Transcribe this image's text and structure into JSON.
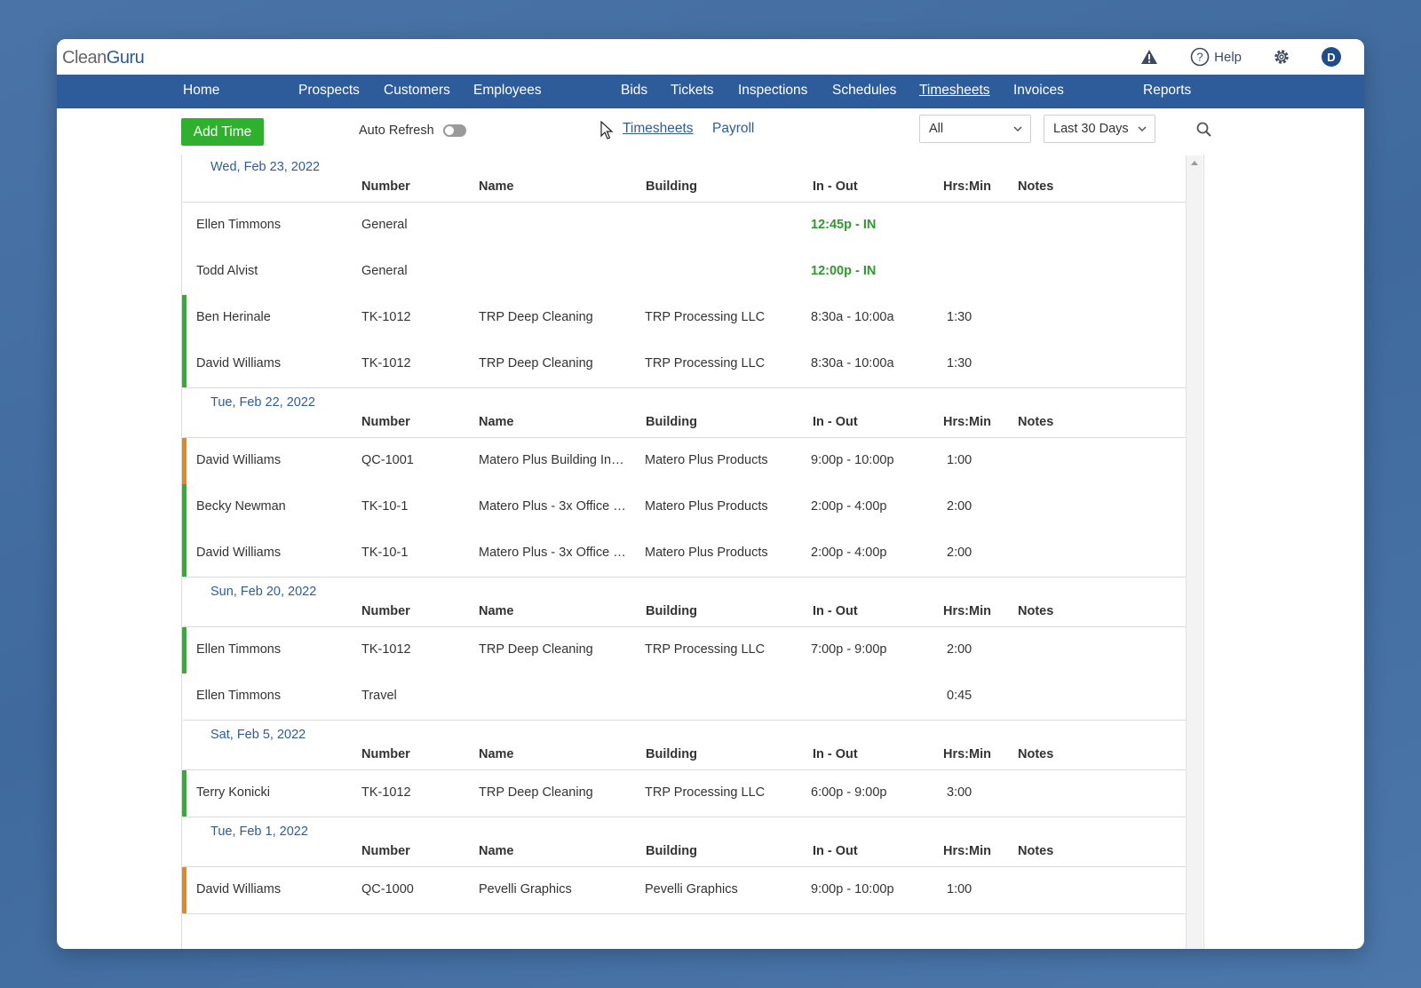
{
  "app": {
    "logo_a": "Clean",
    "logo_b": "Guru",
    "help_label": "Help",
    "avatar_initial": "D"
  },
  "nav": {
    "items": [
      "Home",
      "Prospects",
      "Customers",
      "Employees",
      "Bids",
      "Tickets",
      "Inspections",
      "Schedules",
      "Timesheets",
      "Invoices",
      "Reports"
    ],
    "active": "Timesheets"
  },
  "toolbar": {
    "add_label": "Add Time",
    "auto_refresh_label": "Auto Refresh",
    "tab_timesheets": "Timesheets",
    "tab_payroll": "Payroll",
    "filter_value": "All",
    "range_value": "Last 30 Days"
  },
  "columns": [
    "Number",
    "Name",
    "Building",
    "In - Out",
    "Hrs:Min",
    "Notes"
  ],
  "groups": [
    {
      "date": "Wed, Feb 23, 2022",
      "rows": [
        {
          "employee": "Ellen Timmons",
          "number": "General",
          "name": "",
          "building": "",
          "inout": "12:45p - IN",
          "hrs": "",
          "status": "none",
          "active": true
        },
        {
          "employee": "Todd Alvist",
          "number": "General",
          "name": "",
          "building": "",
          "inout": "12:00p - IN",
          "hrs": "",
          "status": "none",
          "active": true
        },
        {
          "employee": "Ben Herinale",
          "number": "TK-1012",
          "name": "TRP Deep Cleaning",
          "building": "TRP Processing LLC",
          "inout": "8:30a - 10:00a",
          "hrs": "1:30",
          "status": "green",
          "active": false
        },
        {
          "employee": "David Williams",
          "number": "TK-1012",
          "name": "TRP Deep Cleaning",
          "building": "TRP Processing LLC",
          "inout": "8:30a - 10:00a",
          "hrs": "1:30",
          "status": "green",
          "active": false
        }
      ]
    },
    {
      "date": "Tue, Feb 22, 2022",
      "rows": [
        {
          "employee": "David Williams",
          "number": "QC-1001",
          "name": "Matero Plus Building In…",
          "building": "Matero Plus Products",
          "inout": "9:00p - 10:00p",
          "hrs": "1:00",
          "status": "orange",
          "active": false
        },
        {
          "employee": "Becky Newman",
          "number": "TK-10-1",
          "name": "Matero Plus - 3x Office …",
          "building": "Matero Plus Products",
          "inout": "2:00p - 4:00p",
          "hrs": "2:00",
          "status": "green",
          "active": false
        },
        {
          "employee": "David Williams",
          "number": "TK-10-1",
          "name": "Matero Plus - 3x Office …",
          "building": "Matero Plus Products",
          "inout": "2:00p - 4:00p",
          "hrs": "2:00",
          "status": "green",
          "active": false
        }
      ]
    },
    {
      "date": "Sun, Feb 20, 2022",
      "rows": [
        {
          "employee": "Ellen Timmons",
          "number": "TK-1012",
          "name": "TRP Deep Cleaning",
          "building": "TRP Processing LLC",
          "inout": "7:00p - 9:00p",
          "hrs": "2:00",
          "status": "green",
          "active": false
        },
        {
          "employee": "Ellen Timmons",
          "number": "Travel",
          "name": "",
          "building": "",
          "inout": "",
          "hrs": "0:45",
          "status": "none",
          "active": false
        }
      ]
    },
    {
      "date": "Sat, Feb 5, 2022",
      "rows": [
        {
          "employee": "Terry Konicki",
          "number": "TK-1012",
          "name": "TRP Deep Cleaning",
          "building": "TRP Processing LLC",
          "inout": "6:00p - 9:00p",
          "hrs": "3:00",
          "status": "green",
          "active": false
        }
      ]
    },
    {
      "date": "Tue, Feb 1, 2022",
      "rows": [
        {
          "employee": "David Williams",
          "number": "QC-1000",
          "name": "Pevelli Graphics",
          "building": "Pevelli Graphics",
          "inout": "9:00p - 10:00p",
          "hrs": "1:00",
          "status": "orange",
          "active": false
        }
      ]
    }
  ],
  "colors": {
    "nav_bg": "#2e5b9a",
    "add_button": "#2fb12f",
    "status_green": "#2fb12f",
    "status_orange": "#e08a1e",
    "in_text": "#2e9a2e"
  }
}
